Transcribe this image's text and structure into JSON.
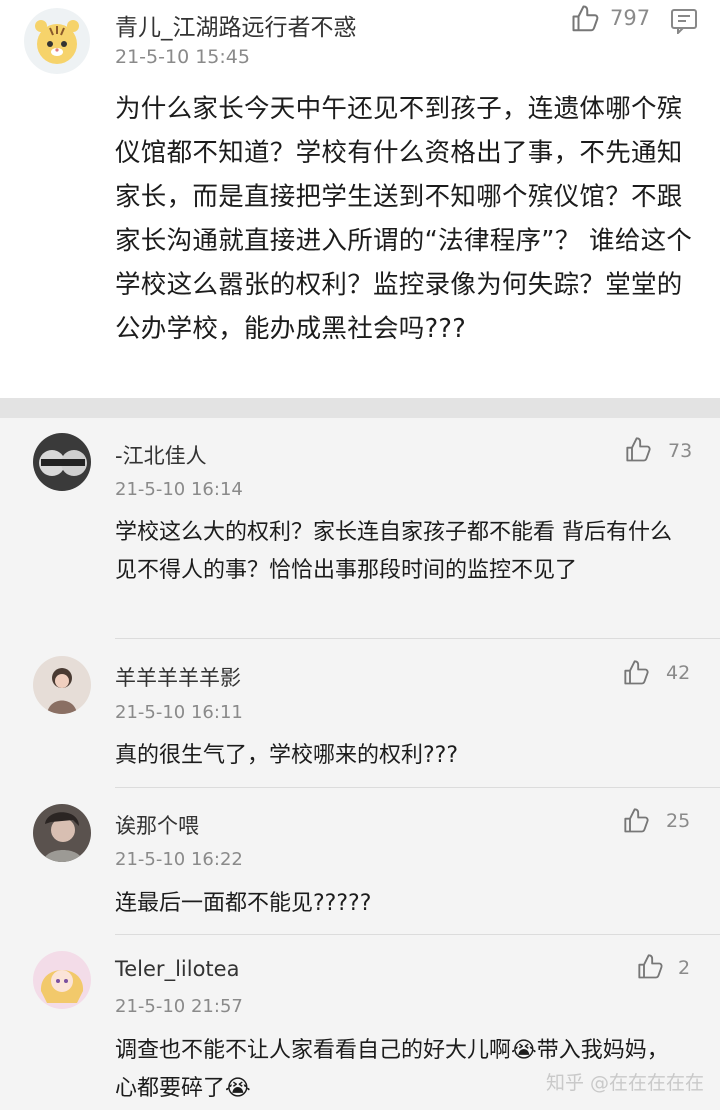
{
  "top_comment": {
    "avatar_icon": "cartoon-tiger-avatar",
    "username": "青儿_江湖路远行者不惑",
    "date": "21-5-10 15:45",
    "likes": "797",
    "text": "为什么家长今天中午还见不到孩子，连遗体哪个殡仪馆都不知道？学校有什么资格出了事，不先通知家长，而是直接把学生送到不知哪个殡仪馆？不跟家长沟通就直接进入所谓的“法律程序”？ 谁给这个学校这么嚣张的权利？监控录像为何失踪？堂堂的公办学校，能办成黑社会吗???"
  },
  "replies": [
    {
      "username": "-江北佳人",
      "date": "21-5-10 16:14",
      "likes": "73",
      "text": "学校这么大的权利？家长连自家孩子都不能看 背后有什么见不得人的事？恰恰出事那段时间的监控不见了"
    },
    {
      "username": "羊羊羊羊羊影",
      "date": "21-5-10 16:11",
      "likes": "42",
      "text": "真的很生气了，学校哪来的权利???"
    },
    {
      "username": "诶那个喂",
      "date": "21-5-10 16:22",
      "likes": "25",
      "text": "连最后一面都不能见?????"
    },
    {
      "username": "Teler_lilotea",
      "date": "21-5-10 21:57",
      "likes": "2",
      "text": "调查也不能不让人家看看自己的好大儿啊😭带入我妈妈，心都要碎了😭"
    }
  ],
  "watermark": "知乎 @在在在在在",
  "colors": {
    "background": "#f4f4f4",
    "main_background": "#ffffff",
    "divider": "#e3e3e3",
    "meta_text": "#8a8a8a"
  }
}
